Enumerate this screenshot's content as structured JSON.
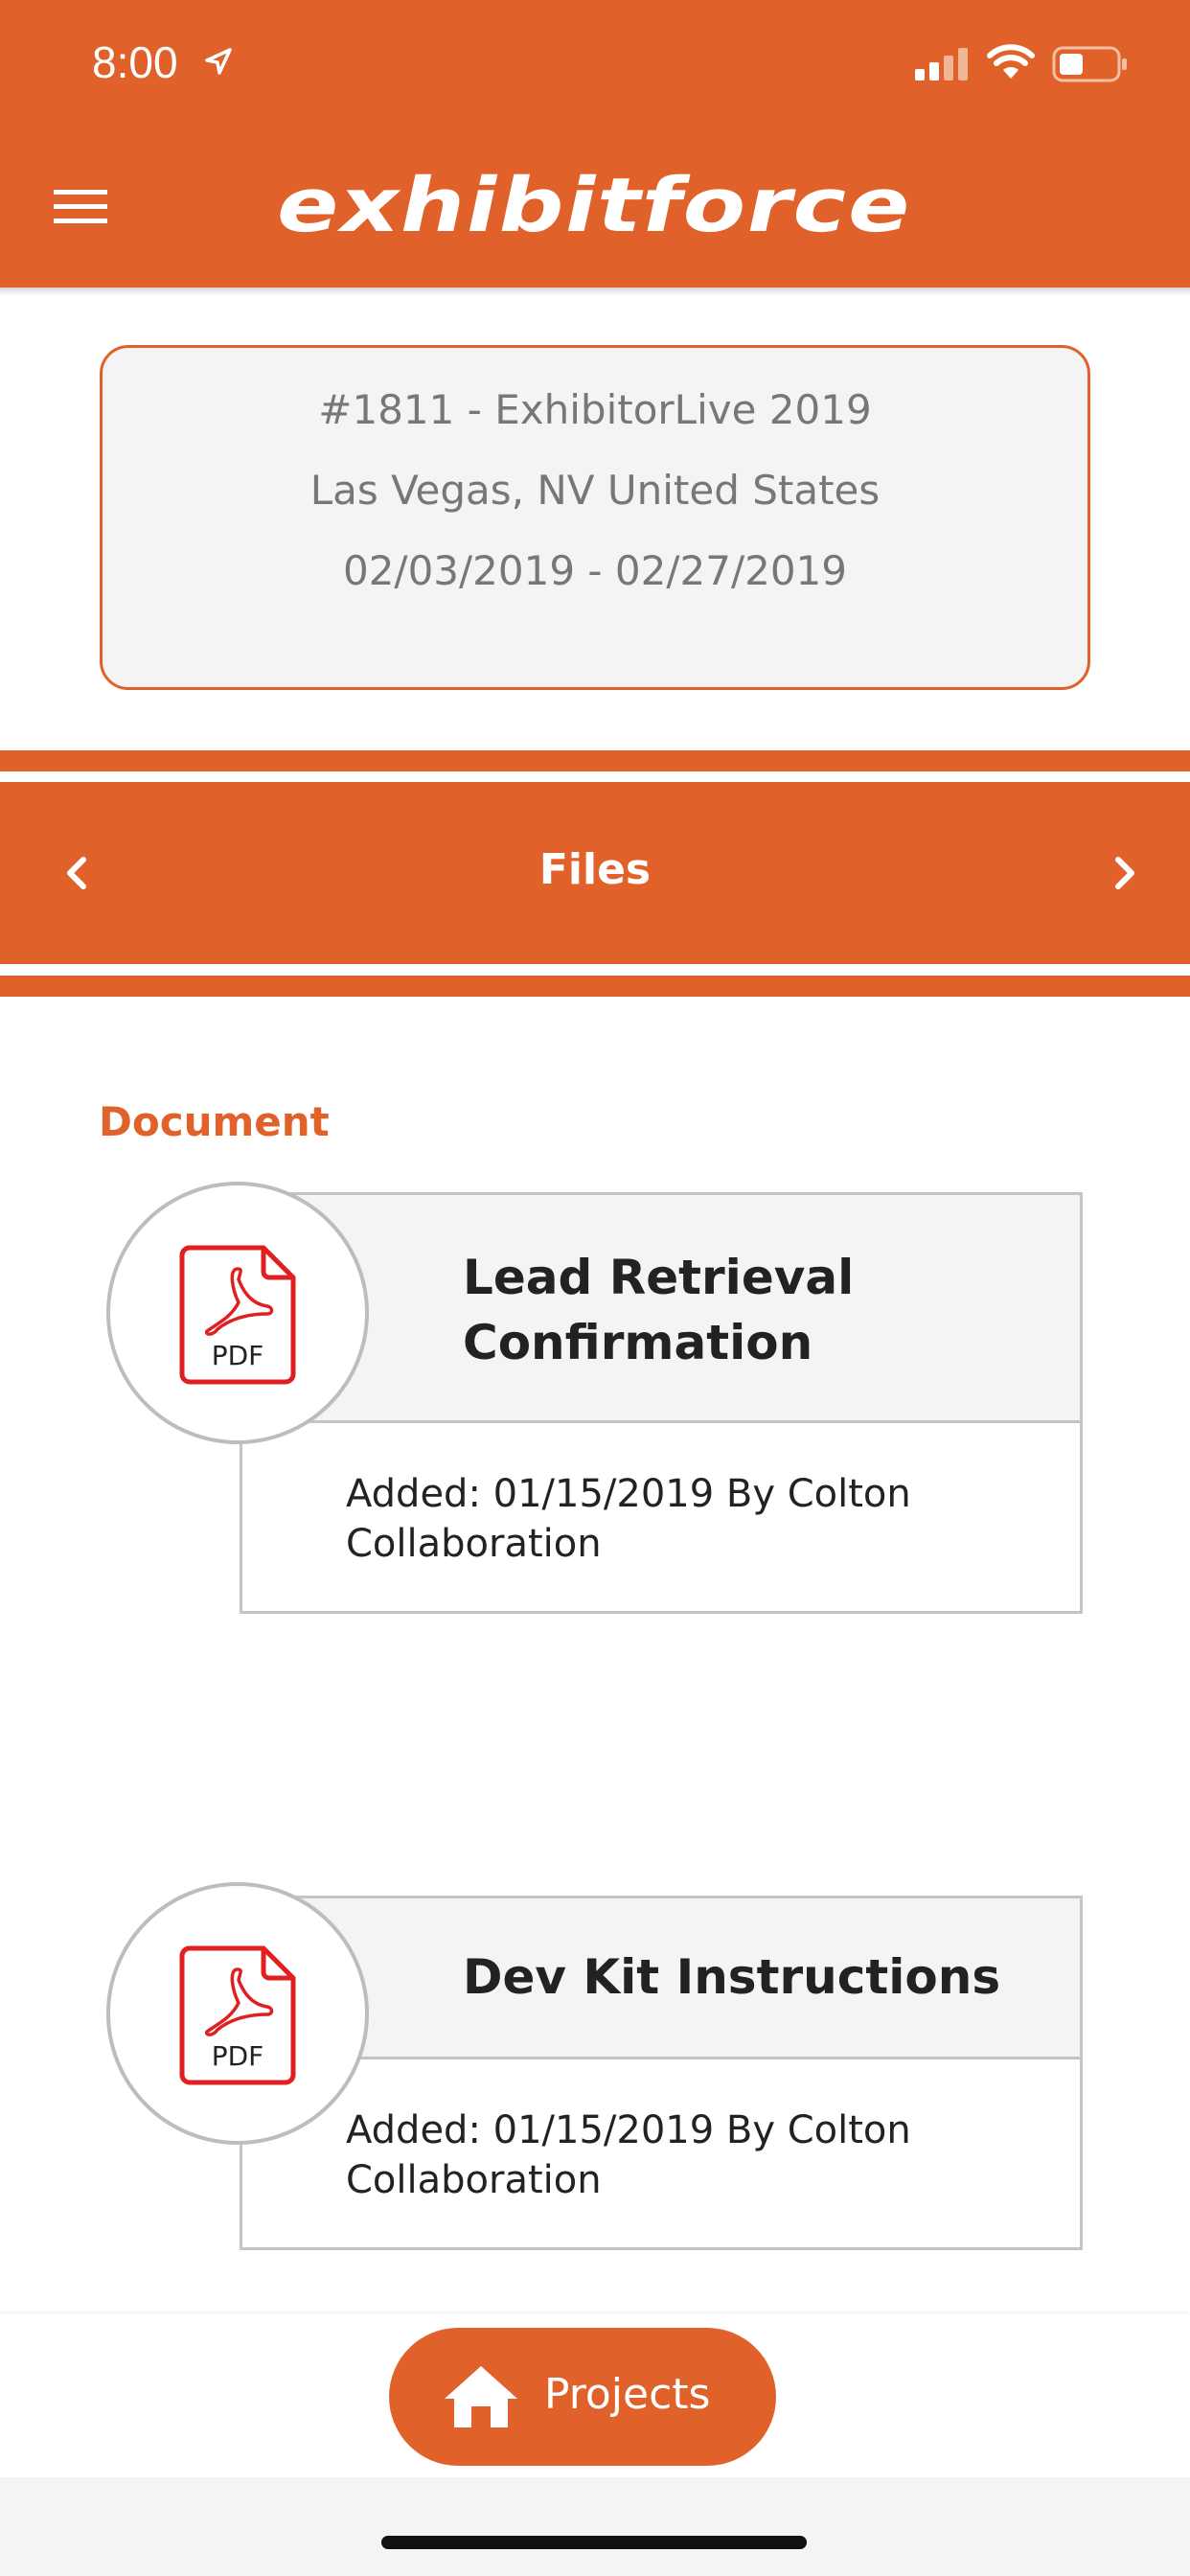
{
  "status_bar": {
    "time": "8:00"
  },
  "header": {
    "brand": "exhibitforce"
  },
  "project": {
    "title": "#1811 - ExhibitorLive 2019",
    "location": "Las Vegas, NV United States",
    "dates": "02/03/2019 - 02/27/2019"
  },
  "section_nav": {
    "title": "Files"
  },
  "section_label": "Document",
  "files": [
    {
      "title_lines": [
        "Lead Retrieval",
        "Confirmation"
      ],
      "meta_lines": [
        "Added: 01/15/2019 By Colton",
        "Collaboration"
      ],
      "icon_label": "PDF"
    },
    {
      "title_lines": [
        "Dev Kit Instructions"
      ],
      "meta_lines": [
        "Added: 01/15/2019 By Colton",
        "Collaboration"
      ],
      "icon_label": "PDF"
    }
  ],
  "bottom_bar": {
    "projects_label": "Projects"
  },
  "colors": {
    "accent": "#e0622a",
    "pdf_red": "#e02020"
  }
}
